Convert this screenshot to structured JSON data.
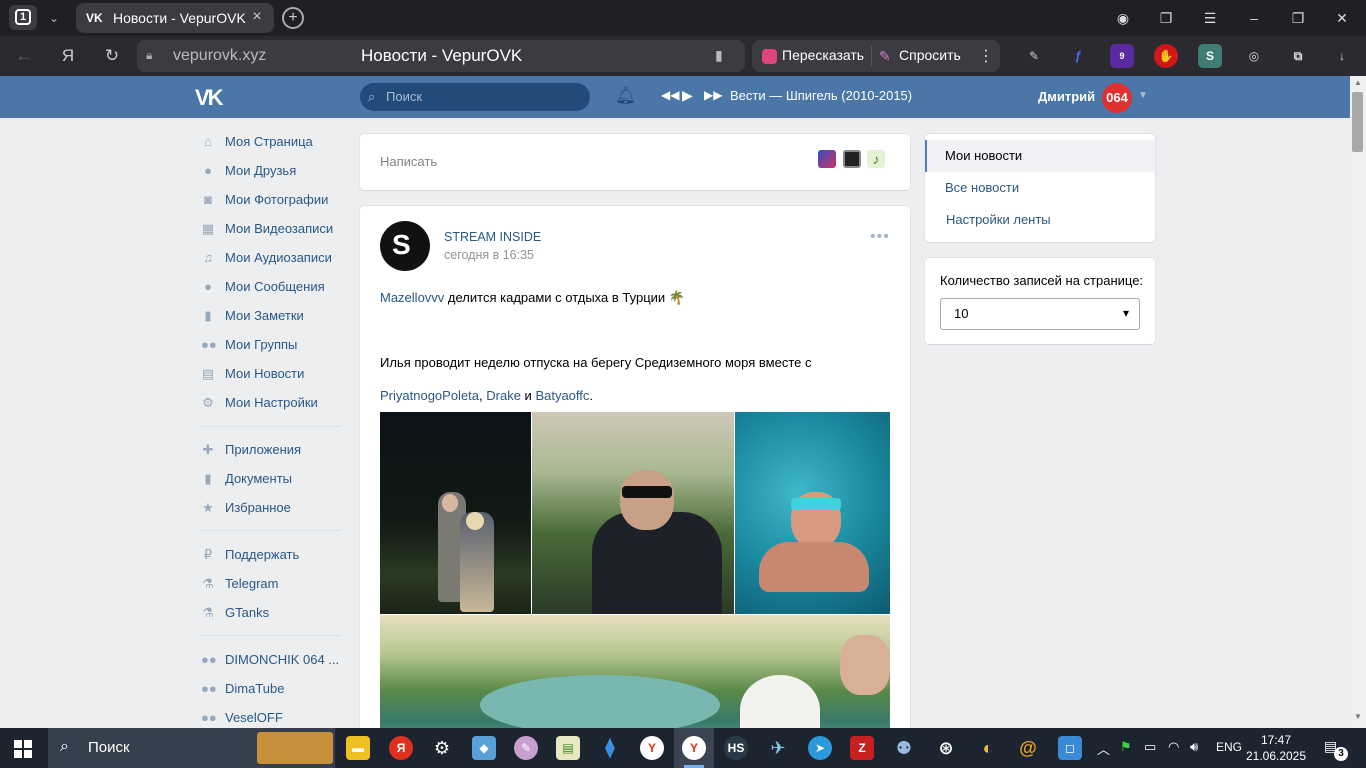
{
  "browser": {
    "tab_count": "1",
    "tab_title": "Новости - VepurOVK",
    "url": "vepurovk.xyz",
    "page_title": "Новости - VepurOVK",
    "ai_retell": "Пересказать",
    "ai_ask": "Спросить"
  },
  "vk": {
    "logo": "VK",
    "search_placeholder": "Поиск",
    "track": "Вести — Шпигель (2010-2015)",
    "user_name": "Дмитрий",
    "avatar_text": "064"
  },
  "left_menu": [
    {
      "label": "Моя Страница",
      "icon": "home-icon"
    },
    {
      "label": "Мои Друзья",
      "icon": "user-icon"
    },
    {
      "label": "Мои Фотографии",
      "icon": "camera-icon"
    },
    {
      "label": "Мои Видеозаписи",
      "icon": "film-icon"
    },
    {
      "label": "Мои Аудиозаписи",
      "icon": "music-icon"
    },
    {
      "label": "Мои Сообщения",
      "icon": "chat-icon"
    },
    {
      "label": "Мои Заметки",
      "icon": "note-icon"
    },
    {
      "label": "Мои Группы",
      "icon": "group-icon"
    },
    {
      "label": "Мои Новости",
      "icon": "news-icon"
    },
    {
      "label": "Мои Настройки",
      "icon": "gear-icon"
    },
    {
      "label": "Приложения",
      "icon": "gamepad-icon"
    },
    {
      "label": "Документы",
      "icon": "document-icon"
    },
    {
      "label": "Избранное",
      "icon": "star-icon"
    },
    {
      "label": "Поддержать",
      "icon": "ruble-icon"
    },
    {
      "label": "Telegram",
      "icon": "flask-icon"
    },
    {
      "label": "GTanks",
      "icon": "flask-icon"
    },
    {
      "label": "DIMONCHIK 064 ...",
      "icon": "group-icon"
    },
    {
      "label": "DimaTube",
      "icon": "group-icon"
    },
    {
      "label": "VeselOFF",
      "icon": "group-icon"
    }
  ],
  "composer": {
    "placeholder": "Написать"
  },
  "post": {
    "author": "STREAM INSIDE",
    "avatar_letter": "S",
    "date": "сегодня в 16:35",
    "line1_link": "Mazellovvv",
    "line1_text": "делится кадрами с отдыха в Турции 🌴",
    "line2_text": "Илья проводит неделю отпуска на берегу Средиземного моря вместе с",
    "line3_link1": "PriyatnogoPoleta",
    "line3_sep1": ", ",
    "line3_link2": "Drake",
    "line3_sep2": " и ",
    "line3_link3": "Batyaoffc",
    "line3_end": "."
  },
  "right_menu": [
    {
      "label": "Мои новости",
      "active": true
    },
    {
      "label": "Все новости",
      "active": false
    },
    {
      "label": "Настройки ленты",
      "active": false
    }
  ],
  "page_size": {
    "label": "Количество записей на странице:",
    "value": "10"
  },
  "taskbar": {
    "search_placeholder": "Поиск",
    "lang": "ENG",
    "time": "17:47",
    "date": "21.06.2025",
    "notifications": "3"
  }
}
